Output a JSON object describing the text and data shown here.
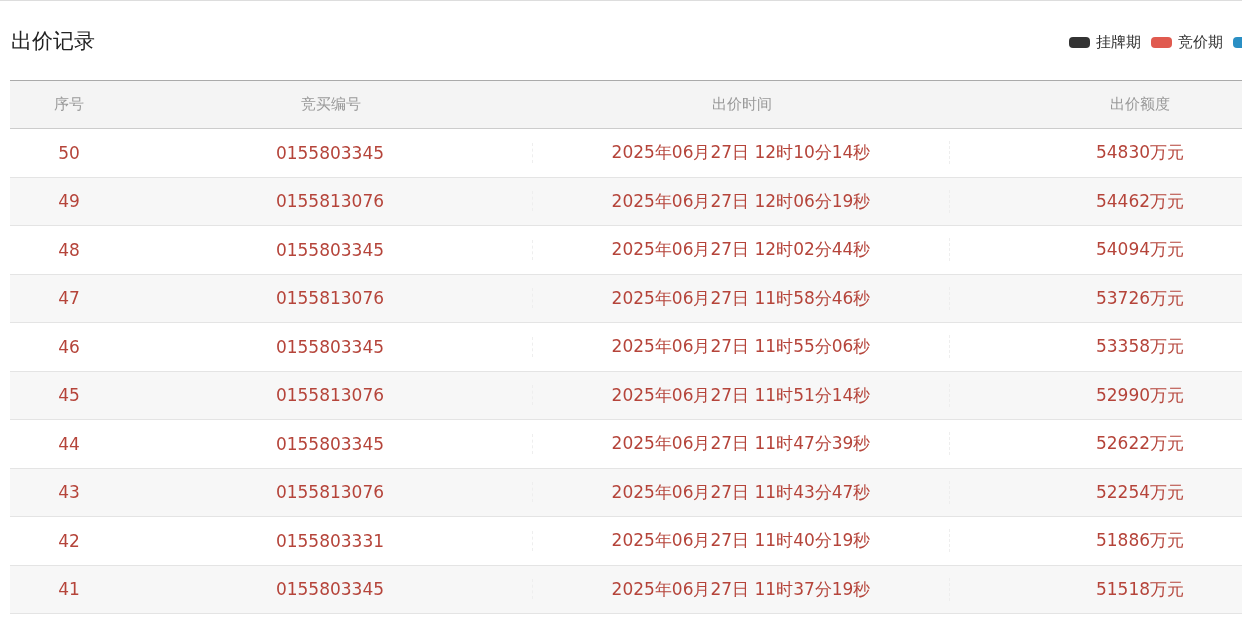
{
  "title": "出价记录",
  "legend": [
    {
      "label": "挂牌期",
      "color": "#333333"
    },
    {
      "label": "竞价期",
      "color": "#e05a4f"
    },
    {
      "color": "#2a8fc4"
    }
  ],
  "table": {
    "columns": [
      "序号",
      "竞买编号",
      "出价时间",
      "出价额度"
    ],
    "rows": [
      [
        "50",
        "0155803345",
        "2025年06月27日 12时10分14秒",
        "54830万元"
      ],
      [
        "49",
        "0155813076",
        "2025年06月27日 12时06分19秒",
        "54462万元"
      ],
      [
        "48",
        "0155803345",
        "2025年06月27日 12时02分44秒",
        "54094万元"
      ],
      [
        "47",
        "0155813076",
        "2025年06月27日 11时58分46秒",
        "53726万元"
      ],
      [
        "46",
        "0155803345",
        "2025年06月27日 11时55分06秒",
        "53358万元"
      ],
      [
        "45",
        "0155813076",
        "2025年06月27日 11时51分14秒",
        "52990万元"
      ],
      [
        "44",
        "0155803345",
        "2025年06月27日 11时47分39秒",
        "52622万元"
      ],
      [
        "43",
        "0155813076",
        "2025年06月27日 11时43分47秒",
        "52254万元"
      ],
      [
        "42",
        "0155803331",
        "2025年06月27日 11时40分19秒",
        "51886万元"
      ],
      [
        "41",
        "0155803345",
        "2025年06月27日 11时37分19秒",
        "51518万元"
      ]
    ]
  }
}
